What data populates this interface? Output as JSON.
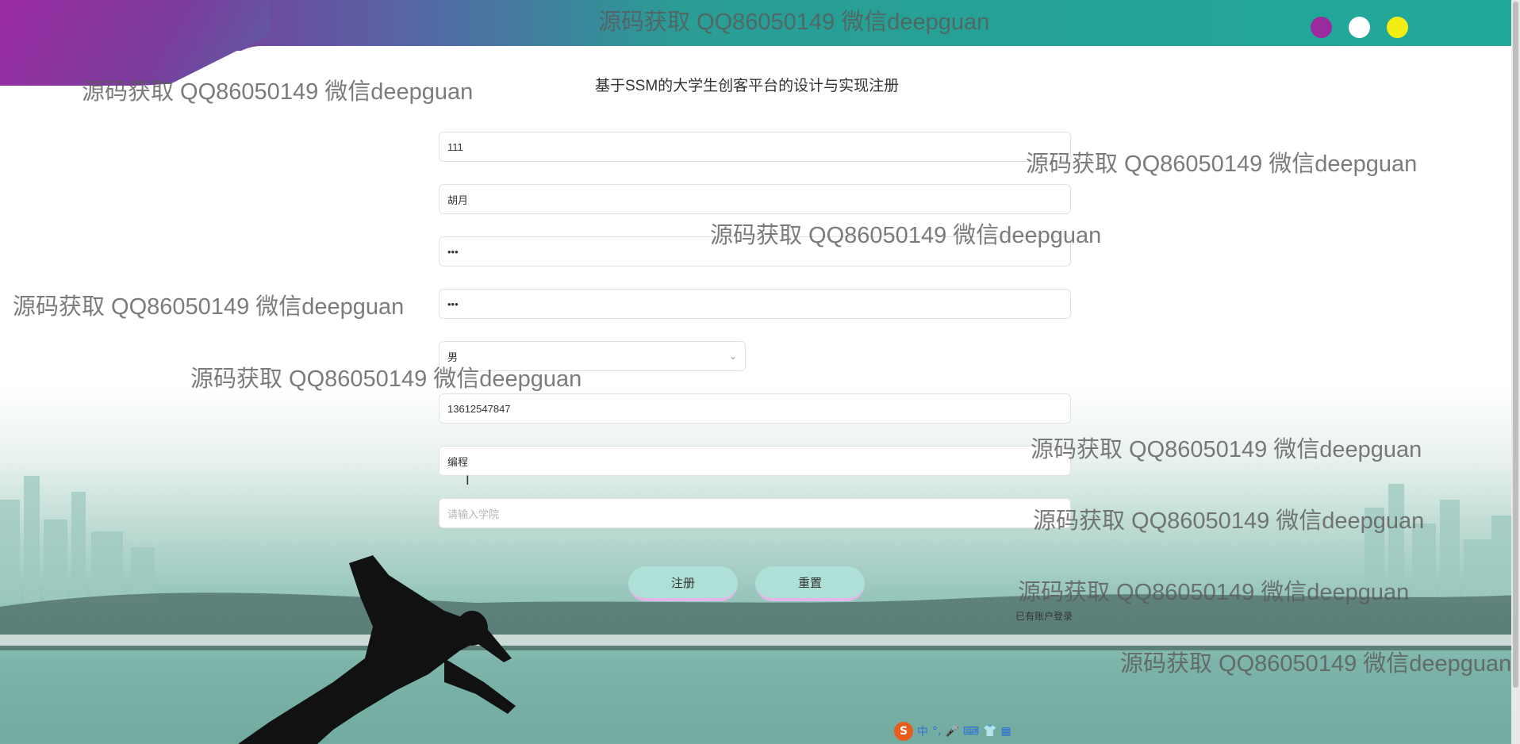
{
  "header": {
    "title": "基于SSM的大学生创客平台的设计与实现注册",
    "dots": [
      {
        "name": "purple-dot",
        "color": "#9b2a9e"
      },
      {
        "name": "white-dot",
        "color": "#ffffff"
      },
      {
        "name": "yellow-dot",
        "color": "#f2ee14"
      }
    ]
  },
  "form": {
    "account": "111",
    "name": "胡月",
    "password": "•••",
    "confirm_password": "•••",
    "gender": "男",
    "phone": "13612547847",
    "specialty": "编程",
    "college_placeholder": "请输入学院"
  },
  "buttons": {
    "register": "注册",
    "reset": "重置"
  },
  "login_link": "已有账户登录",
  "watermark_text": "源码获取 QQ86050149 微信deepguan",
  "colors": {
    "accent": "#20a99a",
    "button": "#aee0d8",
    "button_border": "#e3b6e8"
  },
  "ime": {
    "logo": "S",
    "mode": "中",
    "punct": "°,",
    "icons": [
      "mic-icon",
      "keyboard-icon",
      "skin-icon",
      "toolbox-icon"
    ]
  }
}
